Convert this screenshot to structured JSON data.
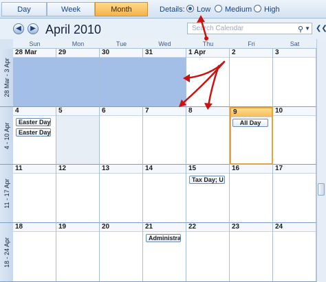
{
  "view_tabs": [
    {
      "label": "Day",
      "active": false
    },
    {
      "label": "Week",
      "active": false
    },
    {
      "label": "Month",
      "active": true
    }
  ],
  "details": {
    "label": "Details:",
    "options": [
      {
        "label": "Low",
        "selected": true
      },
      {
        "label": "Medium",
        "selected": false
      },
      {
        "label": "High",
        "selected": false
      }
    ]
  },
  "nav": {
    "title": "April 2010",
    "back_icon": "arrow-left-icon",
    "forward_icon": "arrow-right-icon"
  },
  "search": {
    "placeholder": "Search Calendar",
    "icon": "search-icon"
  },
  "weekdays": [
    "Sun",
    "Mon",
    "Tue",
    "Wed",
    "Thu",
    "Fri",
    "Sat"
  ],
  "weeks": [
    {
      "label": "28 Mar - 3 Apr",
      "days": [
        "28 Mar",
        "29",
        "30",
        "31",
        "1 Apr",
        "2",
        "3"
      ]
    },
    {
      "label": "4 - 10 Apr",
      "days": [
        "4",
        "5",
        "6",
        "7",
        "8",
        "9",
        "10"
      ]
    },
    {
      "label": "11 - 17 Apr",
      "days": [
        "11",
        "12",
        "13",
        "14",
        "15",
        "16",
        "17"
      ]
    },
    {
      "label": "18 - 24 Apr",
      "days": [
        "18",
        "19",
        "20",
        "21",
        "22",
        "23",
        "24"
      ]
    }
  ],
  "events": {
    "easter_day_1": "Easter Day",
    "easter_day_2": "Easter Day",
    "all_day": "All Day",
    "tax_day": "Tax Day; U",
    "administra": "Administra"
  },
  "colors": {
    "accent": "#f5b24a",
    "selection": "#a4bfe7",
    "arrow": "#cc1111"
  }
}
